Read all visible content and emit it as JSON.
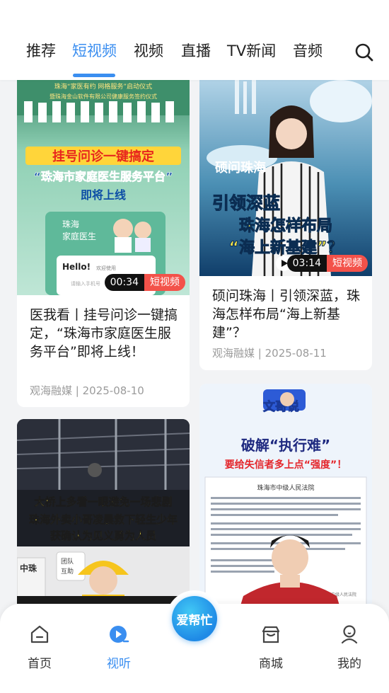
{
  "tabs": [
    {
      "label": "推荐",
      "active": false
    },
    {
      "label": "短视频",
      "active": true
    },
    {
      "label": "视频",
      "active": false
    },
    {
      "label": "直播",
      "active": false
    },
    {
      "label": "TV新闻",
      "active": false
    },
    {
      "label": "音频",
      "active": false
    }
  ],
  "search_icon": "search-icon",
  "accent_color": "#3a8ef0",
  "cards": [
    {
      "thumb_lines": [
        "挂号问诊一键搞定",
        "“珠海市家庭医生服务平台”",
        "即将上线",
        "珠海",
        "家庭医生",
        "Hello!",
        "欢迎使用",
        "请输入手机号",
        "珠海“家医有约 网格服务”启动仪式",
        "暨珠海金山软件有限公司健康服务签约仪式"
      ],
      "duration": "00:34",
      "tag": "短视频",
      "title": "医我看丨挂号问诊一键搞定，“珠海市家庭医生服务平台”即将上线！",
      "source": "观海融媒",
      "date": "2025-08-10"
    },
    {
      "thumb_lines": [
        "硕问珠海",
        "引领深蓝",
        "珠海怎样布局",
        "“海上新基建”？"
      ],
      "duration": "03:14",
      "tag": "短视频",
      "title": "硕问珠海丨引领深蓝，珠海怎样布局“海上新基建”？",
      "source": "观海融媒",
      "date": "2025-08-11"
    },
    {
      "thumb_lines": [
        "大桥上多看一眼避免一场悲剧",
        "珠海外卖小哥凌晨救下轻生少年",
        "获确认为见义勇为人员",
        "中珠",
        "团队",
        "互助"
      ]
    },
    {
      "thumb_lines": [
        "文哥说",
        "破解“执行难”",
        "要给失信者多上点“强度”！",
        "珠海市中级人民法院",
        "珠海市中级人民法院"
      ]
    }
  ],
  "center_button": "爱帮忙",
  "bottom_nav": [
    {
      "label": "首页",
      "icon": "home-icon",
      "active": false
    },
    {
      "label": "视听",
      "icon": "play-icon",
      "active": true
    },
    {
      "label": "商城",
      "icon": "store-icon",
      "active": false
    },
    {
      "label": "我的",
      "icon": "user-icon",
      "active": false
    }
  ]
}
